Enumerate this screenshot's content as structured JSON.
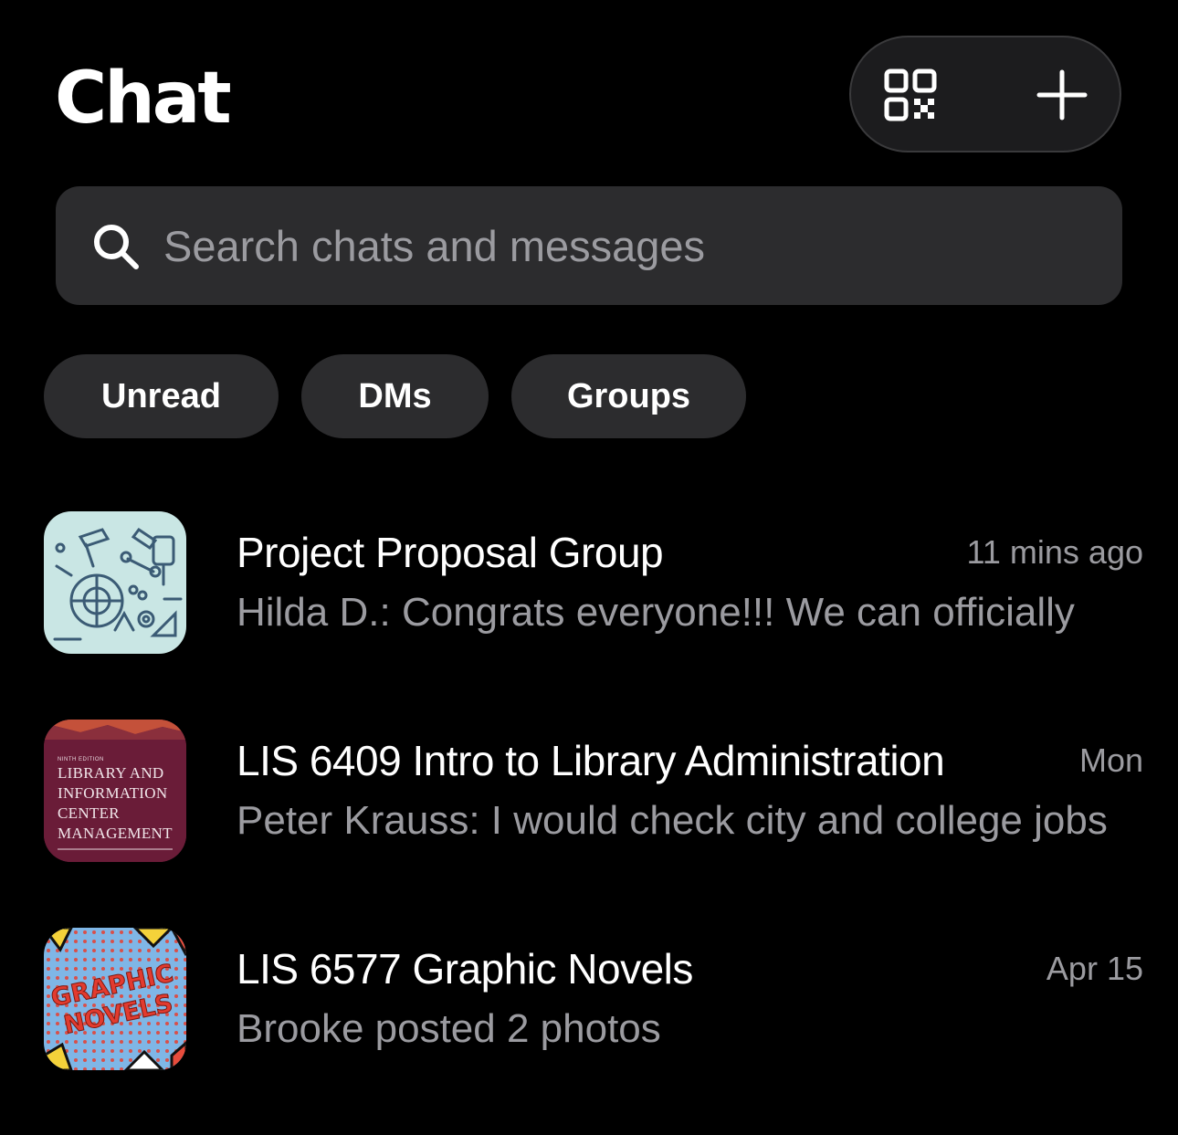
{
  "header": {
    "title": "Chat"
  },
  "search": {
    "placeholder": "Search chats and messages"
  },
  "filters": [
    {
      "label": "Unread"
    },
    {
      "label": "DMs"
    },
    {
      "label": "Groups"
    }
  ],
  "chats": [
    {
      "name": "Project Proposal Group",
      "time": "11 mins ago",
      "preview": "Hilda D.: Congrats everyone!!! We can officially",
      "avatar": "tools-pattern-avatar"
    },
    {
      "name": "LIS 6409 Intro to Library Administration",
      "time": "Mon",
      "preview": "Peter Krauss: I would check city and college jobs",
      "avatar": "book-cover-avatar",
      "avatar_text": {
        "edition": "NINTH EDITION",
        "line1": "LIBRARY AND",
        "line2": "INFORMATION",
        "line3": "CENTER",
        "line4": "MANAGEMENT"
      }
    },
    {
      "name": "LIS 6577 Graphic Novels",
      "time": "Apr 15",
      "preview": "Brooke posted 2 photos",
      "avatar": "graphic-novels-avatar",
      "avatar_text": {
        "line1": "GRAPHIC",
        "line2": "NOVELS"
      }
    }
  ],
  "colors": {
    "background": "#000000",
    "surface": "#2c2c2e",
    "secondary_text": "#9b9ba0",
    "primary_text": "#ffffff"
  }
}
